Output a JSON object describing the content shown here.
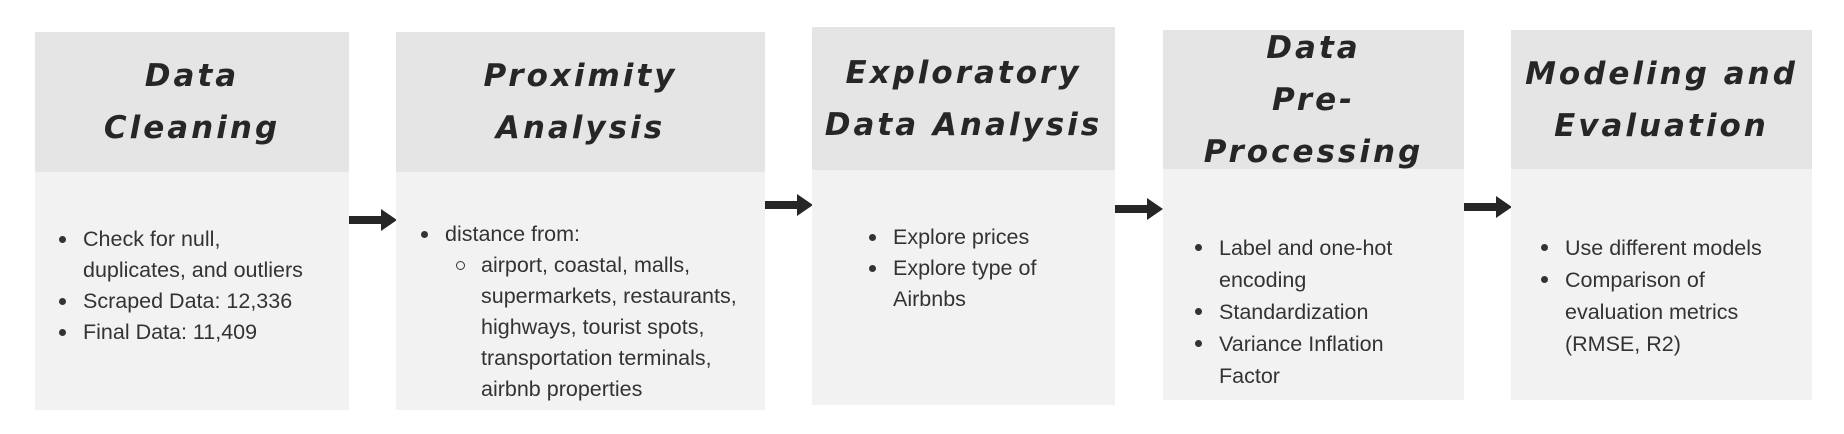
{
  "steps": [
    {
      "title_lines": [
        "Data",
        "Cleaning"
      ],
      "bullets": [
        "Check for null,",
        "duplicates, and outliers",
        "Scraped Data: 12,336",
        "Final Data: 11,409"
      ]
    },
    {
      "title_lines": [
        "Proximity",
        "Analysis"
      ],
      "bullets": [
        "distance from:",
        "airport, coastal, malls,",
        "supermarkets, restaurants,",
        "highways, tourist spots,",
        "transportation terminals,",
        "airbnb properties"
      ]
    },
    {
      "title_lines": [
        "Exploratory",
        "Data Analysis"
      ],
      "bullets": [
        "Explore prices",
        "Explore type of",
        "Airbnbs"
      ]
    },
    {
      "title_lines": [
        "Data",
        "Pre-Processing"
      ],
      "bullets": [
        "Label and one-hot",
        "encoding",
        "Standardization",
        "Variance Inflation",
        "Factor"
      ]
    },
    {
      "title_lines": [
        "Modeling and",
        "Evaluation"
      ],
      "bullets": [
        "Use different models",
        "Comparison of",
        "evaluation metrics",
        "(RMSE, R2)"
      ]
    }
  ],
  "colors": {
    "header": "#e5e5e5",
    "body": "#f2f2f2",
    "text": "#333333",
    "title": "#262626",
    "arrow": "#262626"
  },
  "arrow_icon": "right-arrow-icon"
}
